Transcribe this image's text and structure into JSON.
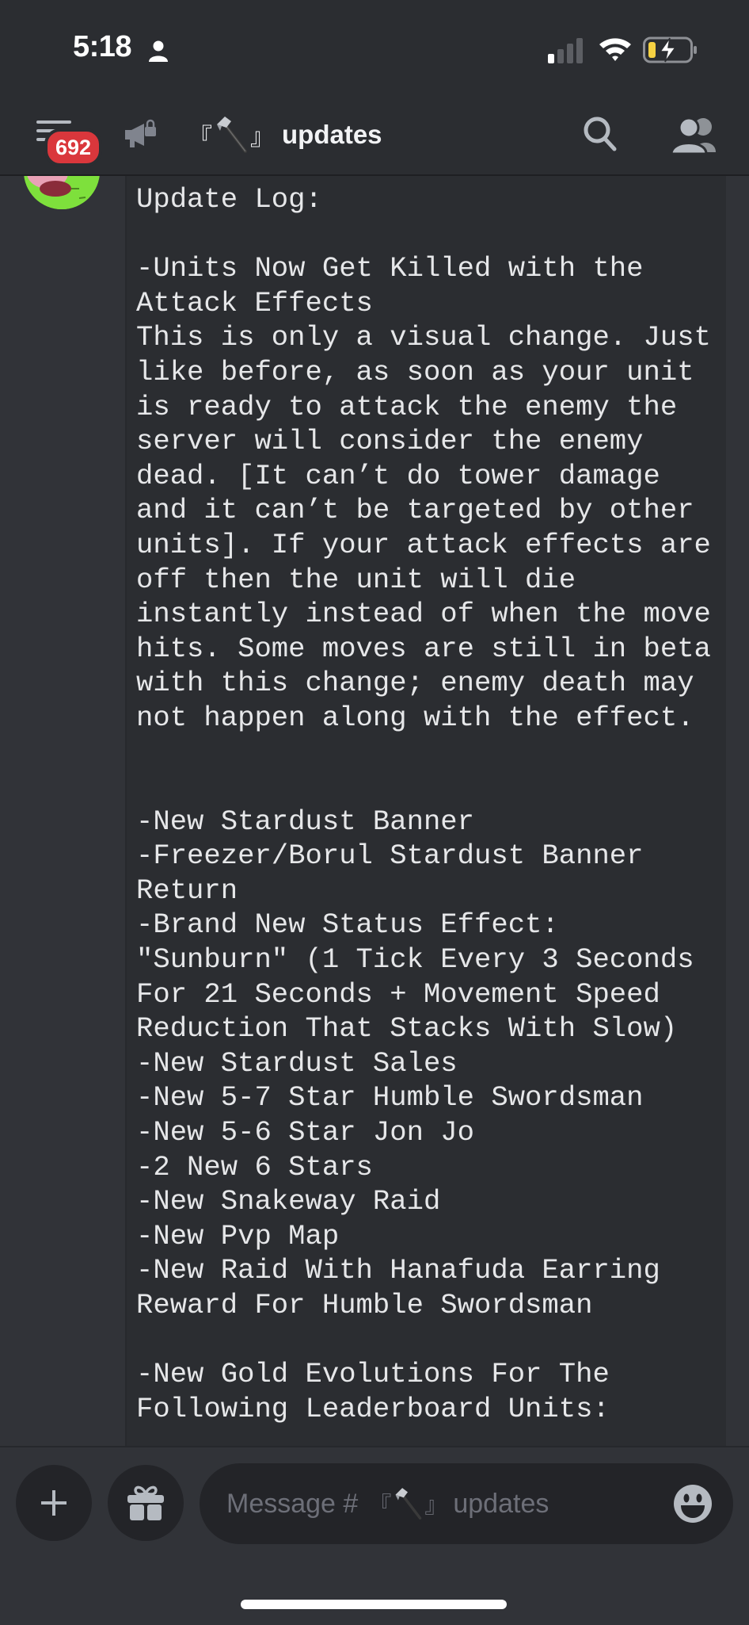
{
  "status_bar": {
    "time": "5:18",
    "icons": [
      "person-icon",
      "cellular-signal-icon",
      "wifi-icon",
      "battery-charging-icon"
    ],
    "battery_color": "#f5d142"
  },
  "header": {
    "unread_badge": "692",
    "channel_prefix_left": "『",
    "channel_prefix_right": "』",
    "channel_emoji": "hammer",
    "channel_name": "updates",
    "icons": [
      "menu-icon",
      "announcement-locked-icon",
      "search-icon",
      "members-icon"
    ]
  },
  "message": {
    "code_lines": [
      "Update Log:",
      "",
      "-Units Now Get Killed with the",
      "Attack Effects",
      "This is only a visual change. Just",
      "like before, as soon as your unit",
      "is ready to attack the enemy the",
      "server will consider the enemy",
      "dead. [It can’t do tower damage",
      "and it can’t be targeted by other",
      "units]. If your attack effects are",
      "off then the unit will die",
      "instantly instead of when the move",
      "hits. Some moves are still in beta",
      "with this change; enemy death may",
      "not happen along with the effect.",
      "",
      "",
      "-New Stardust Banner",
      "-Freezer/Borul Stardust Banner",
      "Return",
      "-Brand New Status Effect:",
      "\"Sunburn\" (1 Tick Every 3 Seconds",
      "For 21 Seconds + Movement Speed",
      "Reduction That Stacks With Slow)",
      "-New Stardust Sales",
      "-New 5-7 Star Humble Swordsman",
      "-New 5-6 Star Jon Jo",
      "-2 New 6 Stars",
      "-New Snakeway Raid",
      "-New Pvp Map",
      "-New Raid With Hanafuda Earring",
      "Reward For Humble Swordsman",
      "",
      "-New Gold Evolutions For The",
      "Following Leaderboard Units:"
    ]
  },
  "composer": {
    "placeholder_prefix": "Message #",
    "placeholder_bracket_left": "『",
    "placeholder_bracket_right": "』",
    "placeholder_channel": "updates",
    "icons": [
      "plus-icon",
      "gift-icon",
      "emoji-icon"
    ]
  },
  "colors": {
    "background": "#313338",
    "header_bg": "#2b2d31",
    "code_bg": "#2b2d31",
    "badge": "#da373c",
    "input_bg": "#232428"
  }
}
